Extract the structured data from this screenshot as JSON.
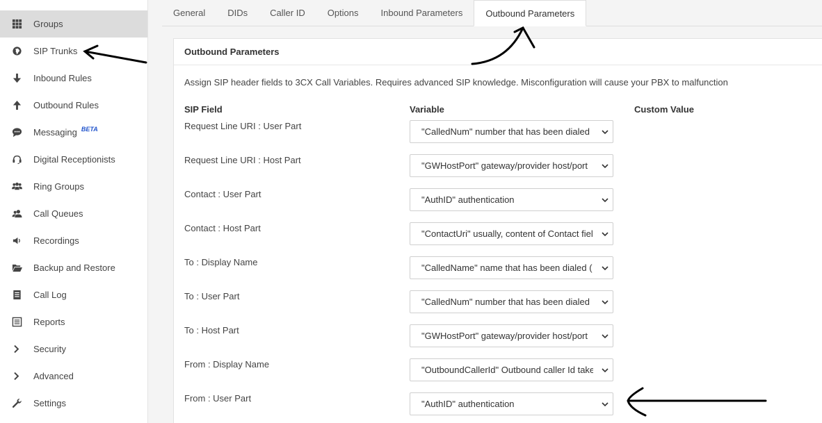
{
  "sidebar": {
    "items": [
      {
        "label": "Groups",
        "icon": "grid-icon",
        "active": true
      },
      {
        "label": "SIP Trunks",
        "icon": "globe-icon"
      },
      {
        "label": "Inbound Rules",
        "icon": "arrow-down-icon"
      },
      {
        "label": "Outbound Rules",
        "icon": "arrow-up-icon"
      },
      {
        "label": "Messaging",
        "icon": "chat-bubble-icon",
        "badge": "BETA"
      },
      {
        "label": "Digital Receptionists",
        "icon": "headset-icon"
      },
      {
        "label": "Ring Groups",
        "icon": "users-icon"
      },
      {
        "label": "Call Queues",
        "icon": "user-group-icon"
      },
      {
        "label": "Recordings",
        "icon": "speaker-icon"
      },
      {
        "label": "Backup and Restore",
        "icon": "folder-open-icon"
      },
      {
        "label": "Call Log",
        "icon": "document-list-icon"
      },
      {
        "label": "Reports",
        "icon": "report-icon"
      },
      {
        "label": "Security",
        "icon": "chevron-right-icon"
      },
      {
        "label": "Advanced",
        "icon": "chevron-right-icon"
      },
      {
        "label": "Settings",
        "icon": "wrench-icon"
      }
    ]
  },
  "tabs": [
    {
      "label": "General"
    },
    {
      "label": "DIDs"
    },
    {
      "label": "Caller ID"
    },
    {
      "label": "Options"
    },
    {
      "label": "Inbound Parameters"
    },
    {
      "label": "Outbound Parameters",
      "active": true
    }
  ],
  "panel": {
    "title": "Outbound Parameters",
    "description": "Assign SIP header fields to 3CX Call Variables. Requires advanced SIP knowledge. Misconfiguration will cause your PBX to malfunction",
    "columns": {
      "field": "SIP Field",
      "variable": "Variable",
      "custom": "Custom Value"
    },
    "rows": [
      {
        "field": "Request Line URI : User Part",
        "variable": "\"CalledNum\" number that has been dialed"
      },
      {
        "field": "Request Line URI : Host Part",
        "variable": "\"GWHostPort\" gateway/provider host/port"
      },
      {
        "field": "Contact : User Part",
        "variable": "\"AuthID\" authentication"
      },
      {
        "field": "Contact : Host Part",
        "variable": "\"ContactUri\" usually, content of Contact field"
      },
      {
        "field": "To : Display Name",
        "variable": "\"CalledName\" name that has been dialed ("
      },
      {
        "field": "To : User Part",
        "variable": "\"CalledNum\" number that has been dialed"
      },
      {
        "field": "To : Host Part",
        "variable": "\"GWHostPort\" gateway/provider host/port"
      },
      {
        "field": "From : Display Name",
        "variable": "\"OutboundCallerId\" Outbound caller Id taken"
      },
      {
        "field": "From : User Part",
        "variable": "\"AuthID\" authentication"
      }
    ]
  },
  "colors": {
    "active_sidebar": "#dcdcdc",
    "link_beta": "#2255cc",
    "annotation": "#000000"
  }
}
